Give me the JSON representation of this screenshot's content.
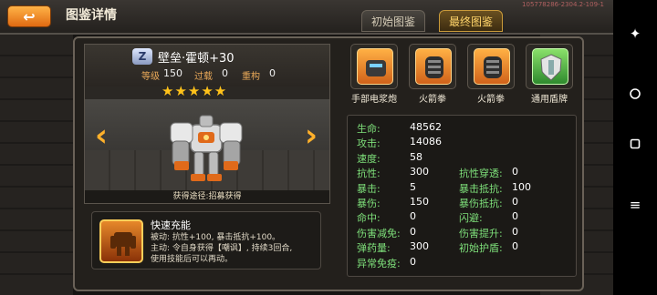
{
  "header": {
    "back_label": "↩",
    "title": "图鉴详情",
    "version": "105778286-2304.2-109-1",
    "tabs": [
      "初始图鉴",
      "最终图鉴"
    ]
  },
  "system_bar": {
    "icons": [
      "accessibility-icon",
      "circle-home-icon",
      "square-recents-icon",
      "menu-icon"
    ]
  },
  "hero": {
    "rank_badge": "Z",
    "name": "壁垒·霍顿+30",
    "level_label": "等级",
    "level": "150",
    "overload_label": "过载",
    "overload": "0",
    "refactor_label": "重构",
    "refactor": "0",
    "stars": "★★★★★",
    "star_count": 5,
    "source": "获得途径:招募获得"
  },
  "skill": {
    "name": "快速充能",
    "desc_lines": [
      "被动: 抗性+100, 暴击抵抗+100。",
      "主动: 令自身获得【嘲讽】, 持续3回合,",
      "使用技能后可以再动。"
    ]
  },
  "equipment": [
    {
      "name": "手部电浆炮",
      "icon": "plasma-cannon-icon",
      "color": "#e07a20"
    },
    {
      "name": "火箭拳",
      "icon": "rocket-fist-icon",
      "color": "#e07a20"
    },
    {
      "name": "火箭拳",
      "icon": "rocket-fist-icon",
      "color": "#e07a20"
    },
    {
      "name": "通用盾牌",
      "icon": "shield-icon",
      "color": "#3aa03a"
    }
  ],
  "attributes": {
    "left": [
      {
        "label": "生命:",
        "value": "48562"
      },
      {
        "label": "攻击:",
        "value": "14086"
      },
      {
        "label": "速度:",
        "value": "58"
      },
      {
        "label": "抗性:",
        "value": "300"
      },
      {
        "label": "暴击:",
        "value": "5"
      },
      {
        "label": "暴伤:",
        "value": "150"
      },
      {
        "label": "命中:",
        "value": "0"
      },
      {
        "label": "伤害减免:",
        "value": "0"
      },
      {
        "label": "弹药量:",
        "value": "300"
      },
      {
        "label": "异常免疫:",
        "value": "0"
      }
    ],
    "right": [
      {
        "label": "抗性穿透:",
        "value": "0"
      },
      {
        "label": "暴击抵抗:",
        "value": "100"
      },
      {
        "label": "暴伤抵抗:",
        "value": "0"
      },
      {
        "label": "闪避:",
        "value": "0"
      },
      {
        "label": "伤害提升:",
        "value": "0"
      },
      {
        "label": "初始护盾:",
        "value": "0"
      }
    ]
  },
  "colors": {
    "accent": "#ffb02a",
    "attr_label": "#7ee07a",
    "star": "#ffc21a"
  }
}
